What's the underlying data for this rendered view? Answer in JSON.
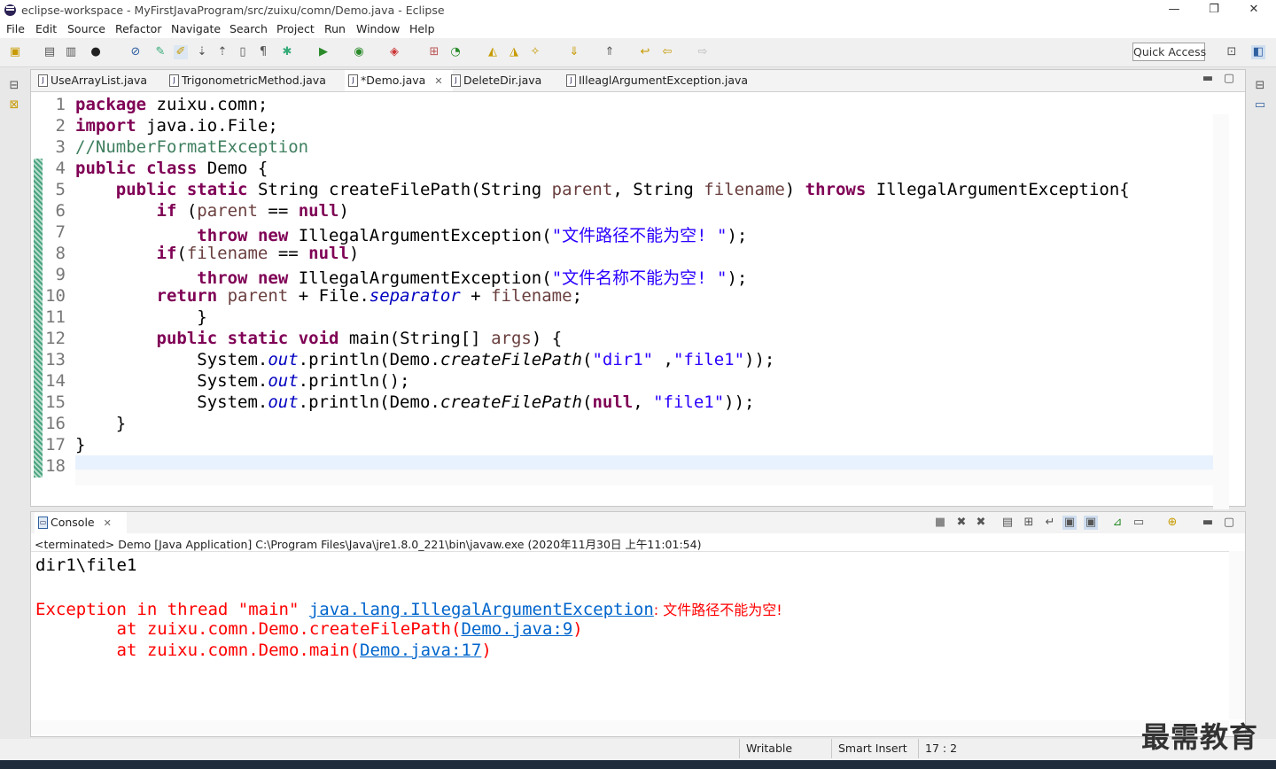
{
  "window": {
    "title": "eclipse-workspace - MyFirstJavaProgram/src/zuixu/comn/Demo.java - Eclipse",
    "minimize": "—",
    "restore": "❐",
    "close": "✕"
  },
  "menu": [
    "File",
    "Edit",
    "Source",
    "Refactor",
    "Navigate",
    "Search",
    "Project",
    "Run",
    "Window",
    "Help"
  ],
  "toolbar": {
    "quick_access": "Quick Access"
  },
  "editor": {
    "tabs": [
      {
        "label": "UseArrayList.java",
        "active": false
      },
      {
        "label": "TrigonometricMethod.java",
        "active": false
      },
      {
        "label": "*Demo.java",
        "active": true
      },
      {
        "label": "DeleteDir.java",
        "active": false
      },
      {
        "label": "IlleaglArgumentException.java",
        "active": false
      }
    ],
    "line_numbers": [
      "1",
      "2",
      "3",
      "4",
      "5",
      "6",
      "7",
      "8",
      "9",
      "10",
      "11",
      "12",
      "13",
      "14",
      "15",
      "16",
      "17",
      "18"
    ]
  },
  "console": {
    "tab_label": "Console",
    "header": "<terminated> Demo [Java Application] C:\\Program Files\\Java\\jre1.8.0_221\\bin\\javaw.exe (2020年11月30日 上午11:01:54)",
    "out_line1": "dir1\\file1",
    "exc_prefix": "Exception in thread \"main\" ",
    "exc_class": "java.lang.IllegalArgumentException",
    "exc_msg": ": 文件路径不能为空!",
    "at1_prefix": "        at zuixu.comn.Demo.createFilePath(",
    "at1_link": "Demo.java:9",
    "at1_suffix": ")",
    "at2_prefix": "        at zuixu.comn.Demo.main(",
    "at2_link": "Demo.java:17",
    "at2_suffix": ")"
  },
  "status": {
    "writable": "Writable",
    "insert_mode": "Smart Insert",
    "position": "17 : 2"
  },
  "watermark": "最需教育"
}
